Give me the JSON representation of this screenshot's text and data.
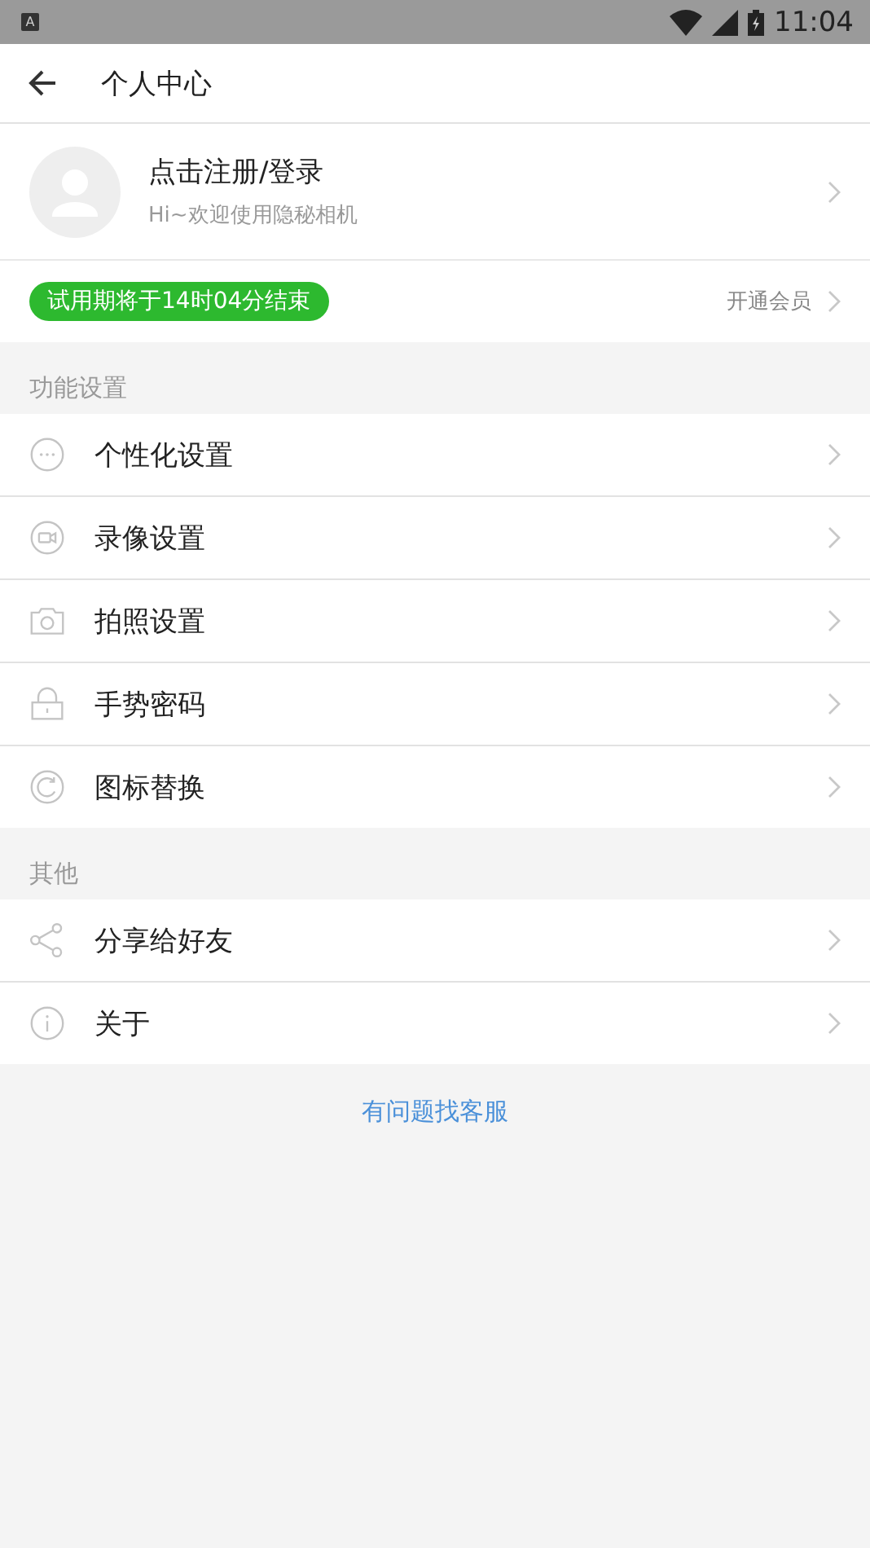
{
  "status_bar": {
    "time": "11:04",
    "notification": "A"
  },
  "header": {
    "title": "个人中心"
  },
  "profile": {
    "name": "点击注册/登录",
    "subtitle": "Hi~欢迎使用隐秘相机"
  },
  "trial": {
    "badge": "试用期将于14时04分结束",
    "action": "开通会员"
  },
  "sections": [
    {
      "title": "功能设置",
      "items": [
        {
          "kind": "more",
          "label": "个性化设置"
        },
        {
          "kind": "video",
          "label": "录像设置"
        },
        {
          "kind": "camera",
          "label": "拍照设置"
        },
        {
          "kind": "lock",
          "label": "手势密码"
        },
        {
          "kind": "refresh",
          "label": "图标替换"
        }
      ]
    },
    {
      "title": "其他",
      "items": [
        {
          "kind": "share",
          "label": "分享给好友"
        },
        {
          "kind": "info",
          "label": "关于"
        }
      ]
    }
  ],
  "support_link": "有问题找客服"
}
